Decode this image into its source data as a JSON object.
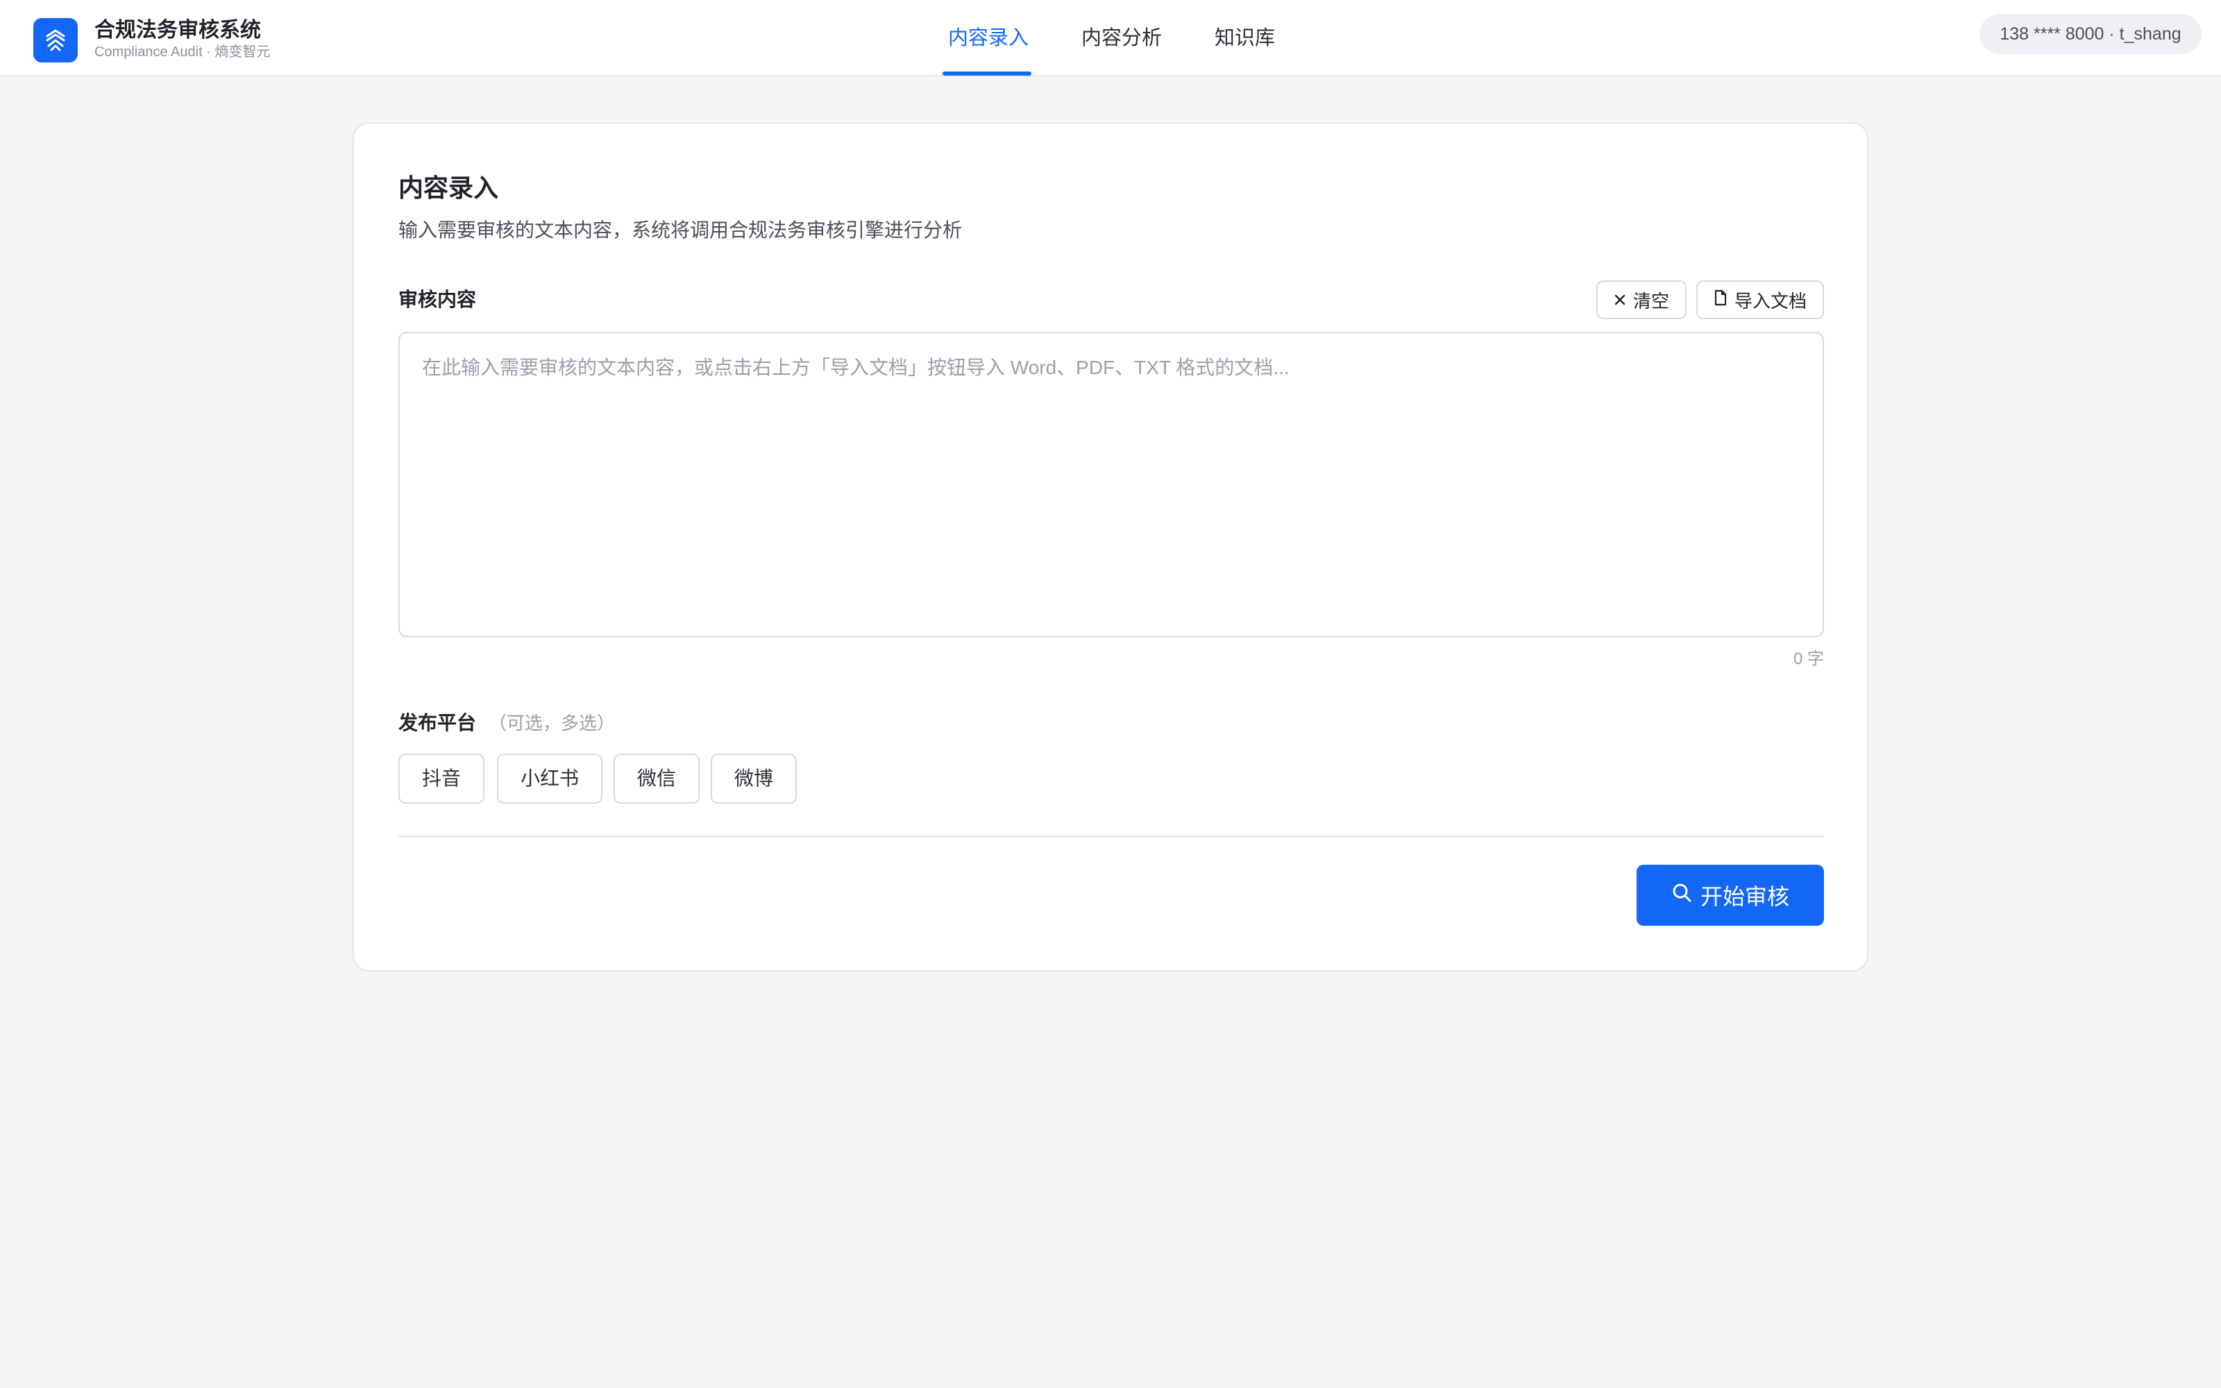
{
  "app": {
    "title": "合规法务审核系统",
    "subtitle": "Compliance Audit · 熵变智元",
    "logo_icon": "logo-mark-icon",
    "brand_color": "#1367f7"
  },
  "nav": {
    "tabs": [
      {
        "label": "内容录入",
        "active": true
      },
      {
        "label": "内容分析",
        "active": false
      },
      {
        "label": "知识库",
        "active": false
      }
    ]
  },
  "user": {
    "label": "138 **** 8000 · t_shang"
  },
  "card": {
    "title": "内容录入",
    "description": "输入需要审核的文本内容，系统将调用合规法务审核引擎进行分析",
    "field_label": "审核内容",
    "clear_button": {
      "label": "清空",
      "icon": "close-icon"
    },
    "import_button": {
      "label": "导入文档",
      "icon": "document-icon"
    },
    "textarea": {
      "value": "",
      "placeholder": "在此输入需要审核的文本内容，或点击右上方「导入文档」按钮导入 Word、PDF、TXT 格式的文档..."
    },
    "char_count": "0 字",
    "platform": {
      "label": "发布平台",
      "hint": "（可选，多选）",
      "options": [
        "抖音",
        "小红书",
        "微信",
        "微博"
      ]
    },
    "start_button": {
      "label": "开始审核",
      "icon": "search-icon"
    }
  }
}
